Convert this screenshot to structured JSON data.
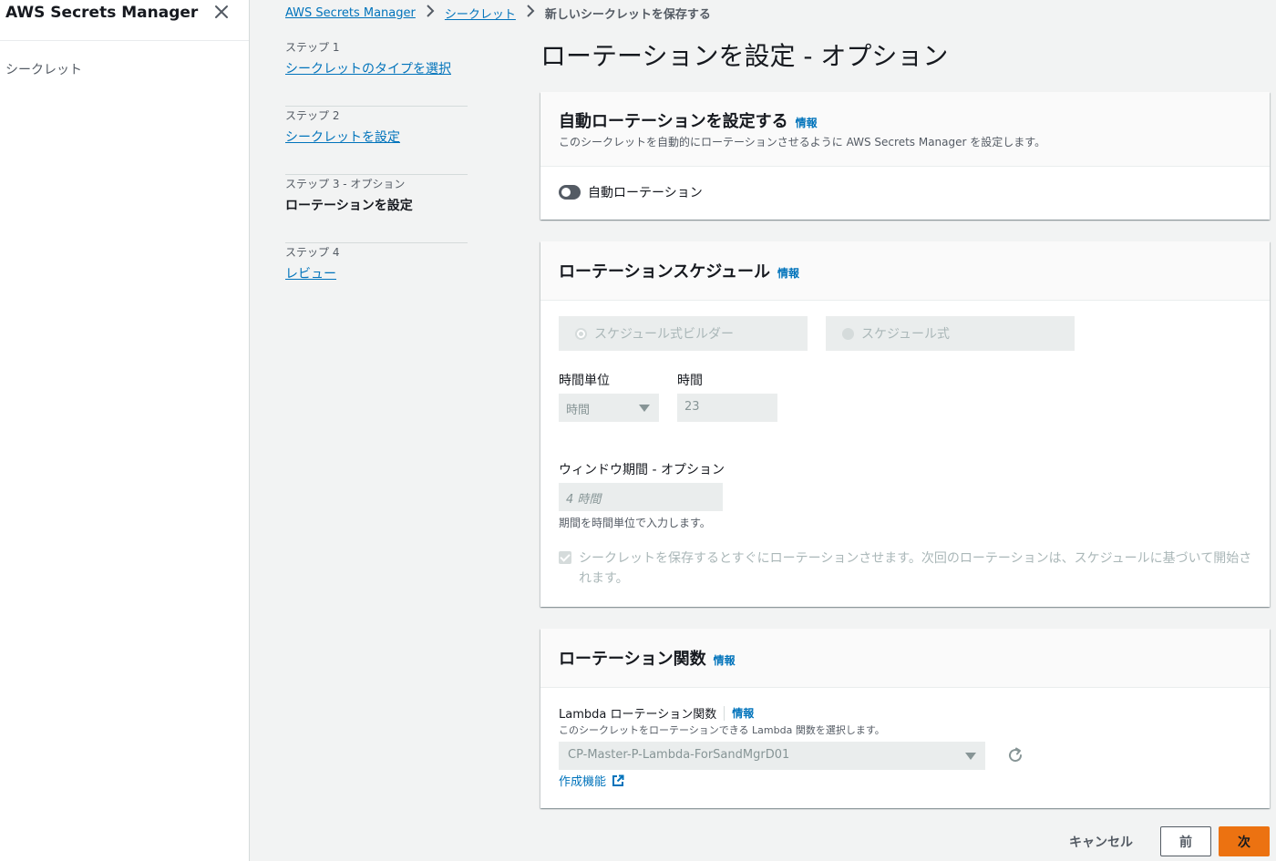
{
  "sidebar": {
    "title": "AWS Secrets Manager",
    "close_icon": "close-icon",
    "items": [
      {
        "label": "シークレット"
      }
    ]
  },
  "breadcrumb": {
    "items": [
      {
        "label": "AWS Secrets Manager",
        "link": true
      },
      {
        "label": "シークレット",
        "link": true
      },
      {
        "label": "新しいシークレットを保存する",
        "link": false
      }
    ],
    "separator_icon": "chevron-right-icon"
  },
  "steps": [
    {
      "label": "ステップ 1",
      "title": "シークレットのタイプを選択",
      "current": false
    },
    {
      "label": "ステップ 2",
      "title": "シークレットを設定",
      "current": false
    },
    {
      "label": "ステップ 3 - オプション",
      "title": "ローテーションを設定",
      "current": true
    },
    {
      "label": "ステップ 4",
      "title": "レビュー",
      "current": false
    }
  ],
  "page": {
    "title": "ローテーションを設定 - オプション"
  },
  "auto_rotation": {
    "title": "自動ローテーションを設定する",
    "info": "情報",
    "description": "このシークレットを自動的にローテーションさせるように AWS Secrets Manager を設定します。",
    "toggle_label": "自動ローテーション",
    "toggle_on": false
  },
  "schedule": {
    "title": "ローテーションスケジュール",
    "info": "情報",
    "radio_builder": "スケジュール式ビルダー",
    "radio_expression": "スケジュール式",
    "time_unit_label": "時間単位",
    "time_unit_value": "時間",
    "hours_label": "時間",
    "hours_value": "23",
    "window_label": "ウィンドウ期間 - オプション",
    "window_placeholder": "4 時間",
    "window_helper": "期間を時間単位で入力します。",
    "rotate_immediately_text": "シークレットを保存するとすぐにローテーションさせます。次回のローテーションは、スケジュールに基づいて開始されます。",
    "rotate_immediately_checked": true
  },
  "lambda": {
    "title": "ローテーション関数",
    "info": "情報",
    "field_label": "Lambda ローテーション関数",
    "field_info": "情報",
    "field_description": "このシークレットをローテーションできる Lambda 関数を選択します。",
    "selected_function": "CP-Master-P-Lambda-ForSandMgrD01",
    "create_link": "作成機能",
    "refresh_icon": "refresh-icon",
    "external_icon": "external-link-icon"
  },
  "footer": {
    "cancel": "キャンセル",
    "previous": "前",
    "next": "次"
  },
  "colors": {
    "link": "#0073bb",
    "primary_button": "#ec7211",
    "disabled_bg": "#eaeded",
    "page_bg": "#f2f3f3"
  }
}
